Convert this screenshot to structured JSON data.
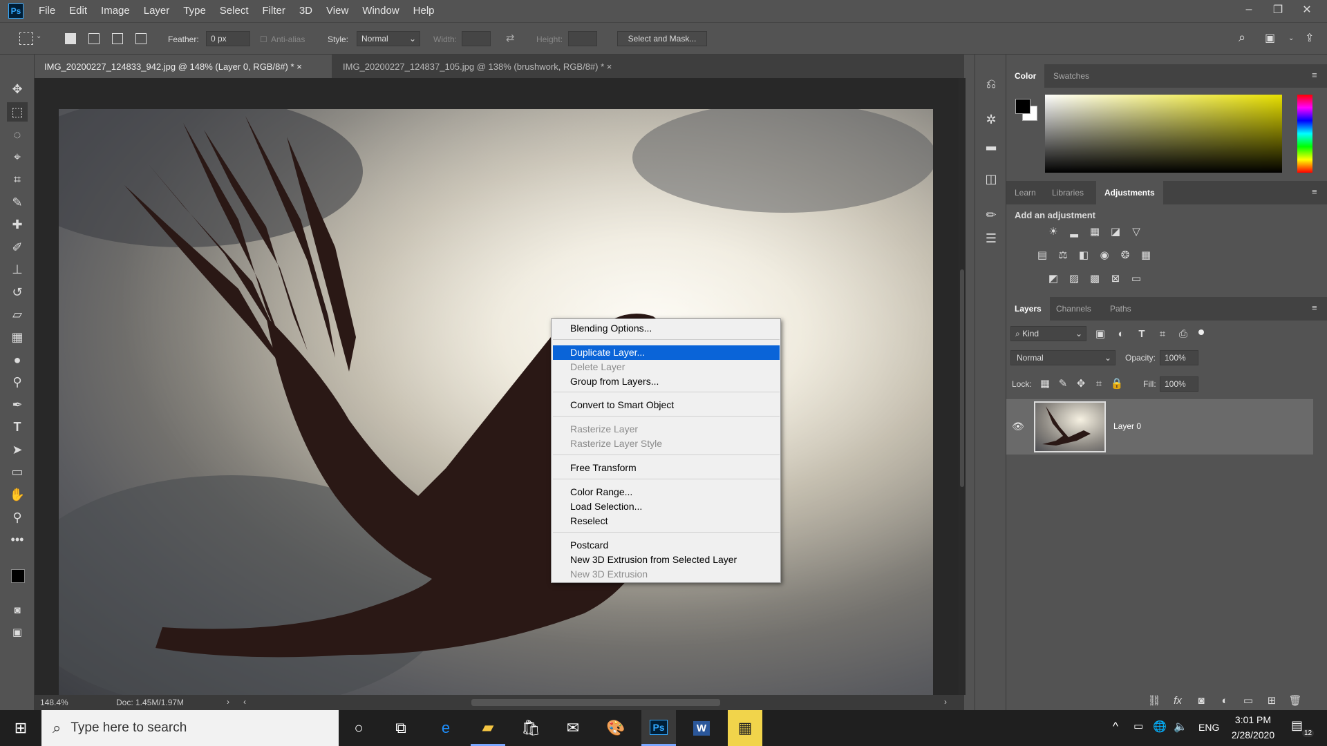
{
  "menubar": {
    "logo": "Ps",
    "items": [
      "File",
      "Edit",
      "Image",
      "Layer",
      "Type",
      "Select",
      "Filter",
      "3D",
      "View",
      "Window",
      "Help"
    ]
  },
  "options": {
    "feather_label": "Feather:",
    "feather_value": "0 px",
    "antialias_label": "Anti-alias",
    "style_label": "Style:",
    "style_value": "Normal",
    "width_label": "Width:",
    "height_label": "Height:",
    "select_mask_label": "Select and Mask..."
  },
  "tabs": [
    {
      "label": "IMG_20200227_124833_942.jpg @ 148% (Layer 0, RGB/8#) *",
      "close": "×"
    },
    {
      "label": "IMG_20200227_124837_105.jpg @ 138% (brushwork, RGB/8#) *",
      "close": "×"
    }
  ],
  "status": {
    "zoom": "148.4%",
    "doc": "Doc: 1.45M/1.97M"
  },
  "context_menu": {
    "items": [
      {
        "label": "Blending Options..."
      },
      {
        "label": "Duplicate Layer..."
      },
      {
        "label": "Delete Layer"
      },
      {
        "label": "Group from Layers..."
      },
      {
        "label": "Convert to Smart Object"
      },
      {
        "label": "Rasterize Layer"
      },
      {
        "label": "Rasterize Layer Style"
      },
      {
        "label": "Free Transform"
      },
      {
        "label": "Color Range..."
      },
      {
        "label": "Load Selection..."
      },
      {
        "label": "Reselect"
      },
      {
        "label": "Postcard"
      },
      {
        "label": "New 3D Extrusion from Selected Layer"
      },
      {
        "label": "New 3D Extrusion"
      }
    ]
  },
  "color_panel": {
    "tabs": [
      "Color",
      "Swatches"
    ]
  },
  "adjust_panel": {
    "tabs": [
      "Learn",
      "Libraries",
      "Adjustments"
    ],
    "heading": "Add an adjustment"
  },
  "layers_panel": {
    "tabs": [
      "Layers",
      "Channels",
      "Paths"
    ],
    "filter": "Kind",
    "blend_mode": "Normal",
    "opacity_label": "Opacity:",
    "opacity_value": "100%",
    "lock_label": "Lock:",
    "fill_label": "Fill:",
    "fill_value": "100%",
    "layer_name": "Layer 0"
  },
  "taskbar": {
    "search_placeholder": "Type here to search",
    "lang": "ENG",
    "time": "3:01 PM",
    "date": "2/28/2020",
    "notif_count": "12"
  },
  "colors": {
    "highlight": "#0a64d8",
    "ps_blue": "#31a8ff",
    "panel_bg": "#535353"
  }
}
